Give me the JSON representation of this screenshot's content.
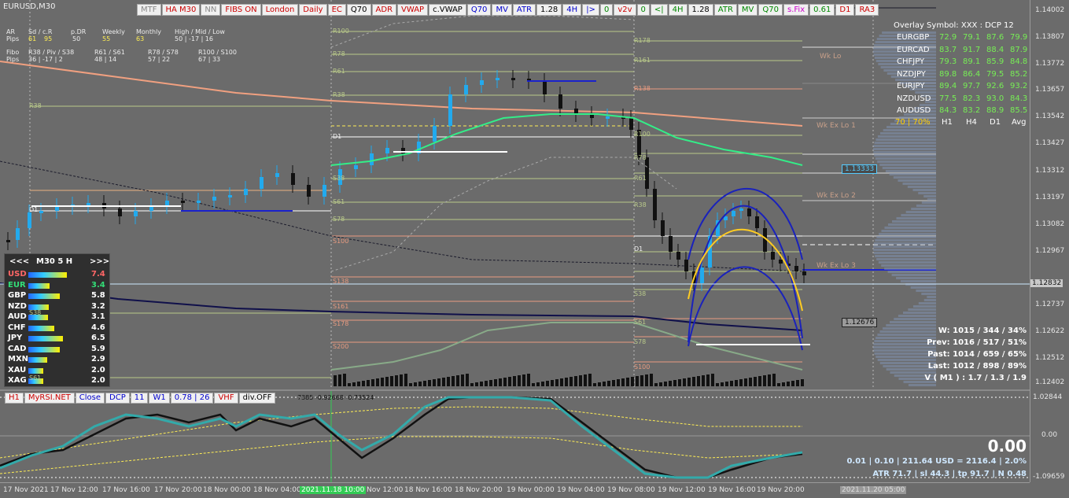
{
  "symbol": "EURUSD,M30",
  "toolbar": [
    {
      "label": "MTF",
      "color": "#888888"
    },
    {
      "label": "HA M30",
      "color": "#cc0000"
    },
    {
      "label": "NN",
      "color": "#888888"
    },
    {
      "label": "FIBS ON",
      "color": "#cc0000"
    },
    {
      "label": "London",
      "color": "#cc0000"
    },
    {
      "label": "Daily",
      "color": "#cc0000"
    },
    {
      "label": "EC",
      "color": "#cc0000"
    },
    {
      "label": "Q70",
      "color": "#000000"
    },
    {
      "label": "ADR",
      "color": "#cc0000"
    },
    {
      "label": "VWAP",
      "color": "#cc0000"
    },
    {
      "label": "c.VWAP",
      "color": "#000000"
    },
    {
      "label": "Q70",
      "color": "#0000cc"
    },
    {
      "label": "MV",
      "color": "#0000cc"
    },
    {
      "label": "ATR",
      "color": "#0000cc"
    },
    {
      "label": "1.28",
      "color": "#000000"
    },
    {
      "label": "4H",
      "color": "#0000cc"
    },
    {
      "label": "|>",
      "color": "#0000cc"
    },
    {
      "label": "0",
      "color": "#008800"
    },
    {
      "label": "v2v",
      "color": "#cc0000"
    },
    {
      "label": "0",
      "color": "#008800"
    },
    {
      "label": "<|",
      "color": "#008800"
    },
    {
      "label": "4H",
      "color": "#008800"
    },
    {
      "label": "1.28",
      "color": "#000000"
    },
    {
      "label": "ATR",
      "color": "#008800"
    },
    {
      "label": "MV",
      "color": "#008800"
    },
    {
      "label": "Q70",
      "color": "#008800"
    },
    {
      "label": "s.Fix",
      "color": "#cc00cc"
    },
    {
      "label": "0.61",
      "color": "#008800"
    },
    {
      "label": "D1",
      "color": "#cc0000"
    },
    {
      "label": "RA3",
      "color": "#cc0000"
    }
  ],
  "info_block": {
    "ar_label": "AR",
    "pips_label": "Pips",
    "sd_cr": "Sd / c.R",
    "p_dr": "p.DR",
    "weekly": "Weekly",
    "monthly": "Monthly",
    "hml": "High / Mid / Low",
    "ar_pips_1": "61",
    "ar_pips_2": "95",
    "p_dr_val": "50",
    "weekly_val": "55",
    "monthly_val": "63",
    "hml_vals": "50  |  -17  |  16",
    "fibo_label": "Fibo",
    "fibo_1": "R38 / Piv / S38",
    "fibo_2": "R61 / S61",
    "fibo_3": "R78 / S78",
    "fibo_4": "R100 / S100",
    "pips_1": "36  |  -17  |  2",
    "pips_2": "48  |  14",
    "pips_3": "57  |  22",
    "pips_4": "67  |  33"
  },
  "strength_panel": {
    "header_left": "<<<",
    "header_mid": "M30  5  H",
    "header_right": ">>>",
    "rows": [
      {
        "cur": "USD",
        "val": "7.4",
        "color": "#ff6666",
        "frac": 0.74
      },
      {
        "cur": "EUR",
        "val": "3.4",
        "color": "#33dd77",
        "frac": 0.34
      },
      {
        "cur": "GBP",
        "val": "5.8",
        "color": "#ffffff",
        "frac": 0.58
      },
      {
        "cur": "NZD",
        "val": "3.2",
        "color": "#ffffff",
        "frac": 0.32
      },
      {
        "cur": "AUD",
        "val": "3.1",
        "color": "#ffffff",
        "frac": 0.31
      },
      {
        "cur": "CHF",
        "val": "4.6",
        "color": "#ffffff",
        "frac": 0.46
      },
      {
        "cur": "JPY",
        "val": "6.5",
        "color": "#ffffff",
        "frac": 0.65
      },
      {
        "cur": "CAD",
        "val": "5.9",
        "color": "#ffffff",
        "frac": 0.59
      },
      {
        "cur": "MXN",
        "val": "2.9",
        "color": "#ffffff",
        "frac": 0.29
      },
      {
        "cur": "XAU",
        "val": "2.0",
        "color": "#ffffff",
        "frac": 0.2
      },
      {
        "cur": "XAG",
        "val": "2.0",
        "color": "#ffffff",
        "frac": 0.2
      }
    ]
  },
  "overlay": {
    "title": "Overlay Symbol: XXX : DCP 12",
    "rows": [
      {
        "pair": "EURGBP",
        "v": [
          "72.9",
          "79.1",
          "87.6",
          "79.9"
        ]
      },
      {
        "pair": "EURCAD",
        "v": [
          "83.7",
          "91.7",
          "88.4",
          "87.9"
        ]
      },
      {
        "pair": "CHFJPY",
        "v": [
          "79.3",
          "89.1",
          "85.9",
          "84.8"
        ]
      },
      {
        "pair": "NZDJPY",
        "v": [
          "89.8",
          "86.4",
          "79.5",
          "85.2"
        ]
      },
      {
        "pair": "EURJPY",
        "v": [
          "89.4",
          "97.7",
          "92.6",
          "93.2"
        ]
      },
      {
        "pair": "NZDUSD",
        "v": [
          "77.5",
          "82.3",
          "93.0",
          "84.3"
        ]
      },
      {
        "pair": "AUDUSD",
        "v": [
          "84.3",
          "83.2",
          "88.9",
          "85.5"
        ]
      }
    ],
    "footer_pct": "70 | 70%",
    "cols": [
      "H1",
      "H4",
      "D1",
      "Avg"
    ]
  },
  "stats": {
    "w": "W: 1015 / 344 / 34%",
    "prev": "Prev: 1016 / 517 / 51%",
    "past": "Past: 1014 / 659 / 65%",
    "last": "Last: 1012 / 898 / 89%",
    "v": "V ( M1 ) : 1.7 / 1.3 / 1.9"
  },
  "price_axis": [
    "1.14002",
    "1.13807",
    "1.13772",
    "1.13657",
    "1.13542",
    "1.13427",
    "1.13312",
    "1.13197",
    "1.13082",
    "1.12967",
    "1.12832",
    "1.12737",
    "1.12622",
    "1.12512",
    "1.12402"
  ],
  "price_tags": {
    "current": "1.12832",
    "box1": "1.13333",
    "box2": "1.12676"
  },
  "level_labels": {
    "wk_lo": "Wk Lo",
    "wk_ex_lo_1": "Wk Ex Lo 1",
    "wk_ex_lo_2": "Wk Ex Lo 2",
    "wk_ex_lo_3": "Wk Ex Lo 3",
    "r100_a": "R100",
    "r78_a": "R78",
    "r61_a": "R61",
    "r38_a": "R38",
    "d1_a": "D1",
    "s38_a": "S38",
    "s61_a": "S61",
    "s78_a": "S78",
    "s100_a": "S100",
    "s138_a": "S138",
    "s161_a": "S161",
    "s178_a": "S178",
    "s200_a": "S200",
    "r178_b": "R178",
    "r161_b": "R161",
    "r138_b": "R138",
    "r100_b": "R100",
    "r78_b": "R78",
    "r61_b": "R61",
    "r38_b": "R38",
    "d1_b": "D1",
    "s38_b": "S38",
    "s61_b": "S61",
    "s78_b": "S78",
    "s100_b": "S100",
    "r38_left": "R38",
    "d1_left": "D1",
    "s38_left": "S38",
    "s61_left": "S61"
  },
  "osc_toolbar": [
    {
      "label": "H1",
      "color": "#cc0000"
    },
    {
      "label": "MyRSI.NET",
      "color": "#cc0000"
    },
    {
      "label": "Close",
      "color": "#0000cc"
    },
    {
      "label": "DCP",
      "color": "#0000cc"
    },
    {
      "label": "11",
      "color": "#0000cc"
    },
    {
      "label": "W1",
      "color": "#0000cc"
    },
    {
      "label": "0.78 | 26",
      "color": "#0000cc"
    },
    {
      "label": "VHF",
      "color": "#cc0000"
    },
    {
      "label": "div.OFF",
      "color": "#000000"
    }
  ],
  "osc_values_text": "7385  -0.92668  -0.73524",
  "osc_axis": [
    "1.02844",
    "0.00",
    "-1.09659"
  ],
  "osc_big_value": "0.00",
  "osc_line1": "0.01  |  0.10  |  211.64 USD = 2116.4  |  2.0%",
  "osc_line2": "ATR 71.7  |  sl 44.3  |  tp 91.7  |  N 0.48",
  "time_axis": [
    "17 Nov 2021",
    "17 Nov 12:00",
    "17 Nov 16:00",
    "17 Nov 20:00",
    "18 Nov 00:00",
    "18 Nov 04:00",
    "2021.11.18 10:00",
    "Nov 12:00",
    "18 Nov 16:00",
    "18 Nov 20:00",
    "19 Nov 00:00",
    "19 Nov 04:00",
    "19 Nov 08:00",
    "19 Nov 12:00",
    "19 Nov 16:00",
    "19 Nov 20:00",
    "2021.11.20 05:00"
  ]
}
